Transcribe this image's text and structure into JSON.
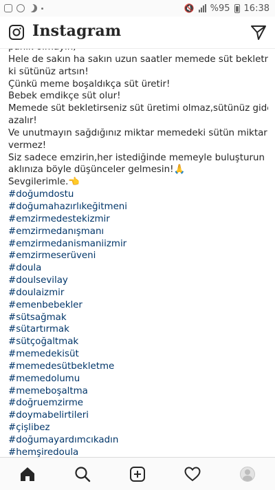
{
  "status_bar": {
    "battery_percent": "%95",
    "time": "16:38"
  },
  "app_bar": {
    "title": "Instagram"
  },
  "caption": {
    "lines": [
      "panik olmayın,",
      "Hele de sakın ha sakın uzun saatler memede süt bekletmeyin",
      "ki sütünüz artsın!",
      "Çünkü meme boşaldıkça süt üretir!",
      "Bebek emdikçe süt olur!",
      "Memede süt bekletirseniz süt üretimi olmaz,sütünüz giderek",
      "azalır!",
      "Ve unutmayın sağdığınız miktar memedeki sütün miktarını",
      "vermez!",
      "Siz sadece emzirin,her istediğinde memeyle buluşturun ki",
      "aklınıza böyle düşünceler gelmesin!🙏",
      "Sevgilerimle.👈"
    ],
    "hashtags": [
      "#doğumdostu",
      "#doğumahazırlıkeğitmeni",
      "#emzirmedestekizmir",
      "#emzirmedanışmanı",
      "#emzirmedanismaniizmir",
      "#emzirmeserüveni",
      "#doula",
      "#doulsevilay",
      "#doulaizmir",
      "#emenbebekler",
      "#sütsağmak",
      "#sütartırmak",
      "#sütçoğaltmak",
      "#memedekisüt",
      "#memedesütbekletme",
      "#memedolumu",
      "#memeboşaltma",
      "#doğruemzirme",
      "#doymabelirtileri",
      "#çişlibez",
      "#doğumayardımcıkadın",
      "#hemşiredoula"
    ]
  },
  "bottom_nav": {
    "items": [
      "home-icon",
      "search-icon",
      "new-post-icon",
      "activity-icon",
      "profile-avatar"
    ]
  },
  "colors": {
    "hashtag": "#003569",
    "text": "#262626"
  }
}
